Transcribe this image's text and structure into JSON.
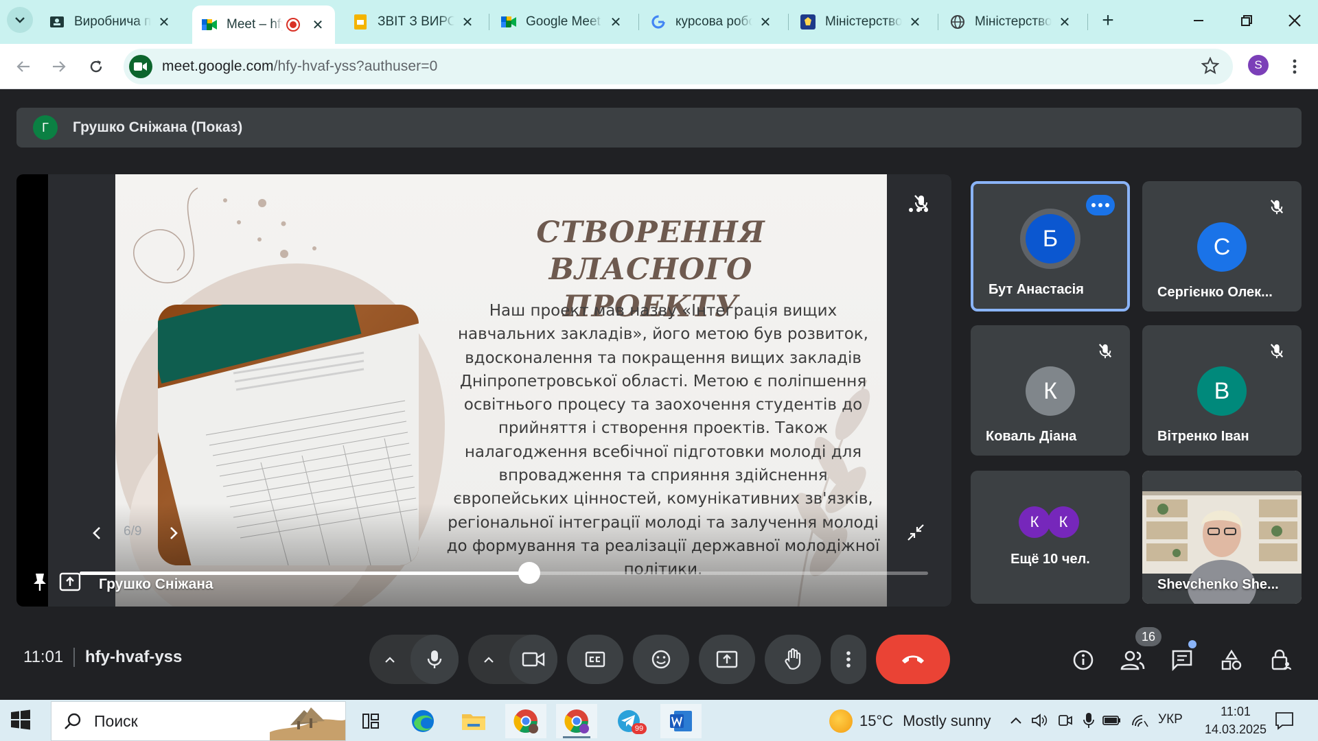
{
  "browser": {
    "tabs": [
      {
        "title": "Виробнича практика",
        "icon": "classroom-icon",
        "active": false
      },
      {
        "title": "Meet – hfy-hvaf-yss",
        "icon": "meet-icon",
        "active": true,
        "recording": true
      },
      {
        "title": "ЗВІТ З ВИРОБНИЧОЇ",
        "icon": "slides-icon",
        "active": false
      },
      {
        "title": "Google Meet",
        "icon": "meet-icon",
        "active": false
      },
      {
        "title": "курсова робота",
        "icon": "google-icon",
        "active": false
      },
      {
        "title": "Міністерство освіти",
        "icon": "ministry-icon",
        "active": false
      },
      {
        "title": "Міністерство освіти",
        "icon": "globe-icon",
        "active": false
      }
    ],
    "url_host": "meet.google.com",
    "url_path": "/hfy-hvaf-yss?authuser=0",
    "profile_initial": "S",
    "accent_color": "#caf2f0"
  },
  "meet": {
    "presenter_banner": {
      "initial": "Г",
      "name": "Грушко Сніжана (Показ)"
    },
    "stage": {
      "presenter_name": "Грушко Сніжана",
      "slide_counter": "6/9",
      "progress": 0.53,
      "slide": {
        "title": "СТВОРЕННЯ ВЛАСНОГО ПРОЕКТУ",
        "body": "Наш проект мав назву «Інтеграція вищих навчальних закладів», його метою був розвиток, вдосконалення та покращення вищих закладів Дніпропетровської області. Метою є поліпшення освітнього процесу та заохочення студентів до прийняття і створення проектів. Також налагодження всебічної підготовки молоді для впровадження та сприяння здійснення європейських цінностей, комунікативних зв'язків, регіональної інтеграції молоді та залучення молоді до формування та реалізації державної молодіжної політики."
      }
    },
    "participants": [
      {
        "name": "Бут Анастасія",
        "initial": "Б",
        "color": "#0b57d0",
        "speaking": true,
        "muted": false
      },
      {
        "name": "Сергієнко Олек...",
        "initial": "С",
        "color": "#1a73e8",
        "speaking": false,
        "muted": true
      },
      {
        "name": "Коваль Діана",
        "initial": "К",
        "color": "#80868b",
        "speaking": false,
        "muted": true
      },
      {
        "name": "Вітренко Іван",
        "initial": "В",
        "color": "#00897b",
        "speaking": false,
        "muted": true
      },
      {
        "more_label": "Ещё 10 чел.",
        "initials": [
          "К",
          "К"
        ]
      },
      {
        "name": "Shevchenko She...",
        "video": true
      }
    ],
    "footer": {
      "time": "11:01",
      "meeting_code": "hfy-hvaf-yss",
      "participants_count": "16"
    }
  },
  "taskbar": {
    "search_label": "Поиск",
    "weather": {
      "temp": "15°C",
      "desc": "Mostly sunny"
    },
    "lang": "УКР",
    "time": "11:01",
    "date": "14.03.2025",
    "telegram_badge": "99"
  }
}
